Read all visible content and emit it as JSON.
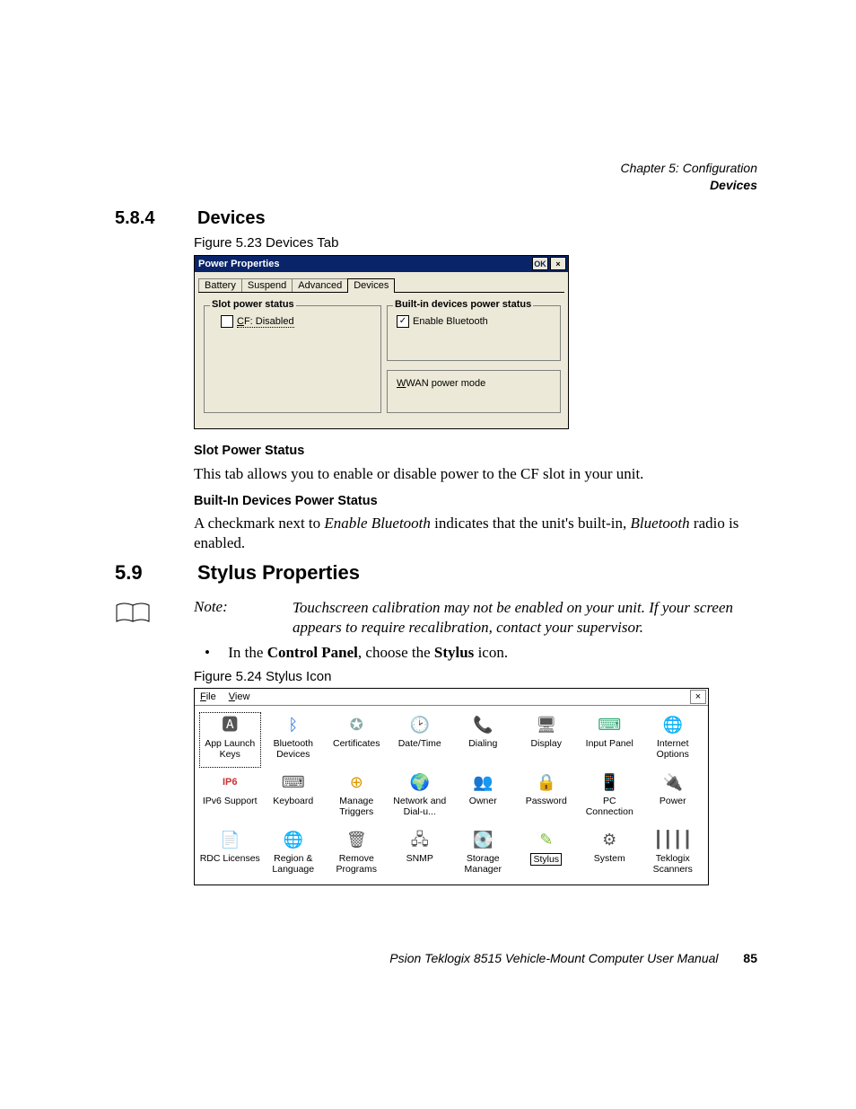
{
  "runningHead": {
    "line1": "Chapter 5: Configuration",
    "line2": "Devices"
  },
  "sec584": {
    "num": "5.8.4",
    "title": "Devices"
  },
  "fig523": "Figure 5.23 Devices Tab",
  "dlg": {
    "title": "Power Properties",
    "ok": "OK",
    "close": "×",
    "tabs": [
      "Battery",
      "Suspend",
      "Advanced",
      "Devices"
    ],
    "activeTab": 3,
    "grp1": {
      "legend": "Slot power status",
      "cfPrefix": "C",
      "cfRest": "F: Disabled",
      "checked": false
    },
    "grp2": {
      "legend": "Built-in devices power status",
      "label": "Enable Bluetooth",
      "checked": true
    },
    "grp3": {
      "legend": "",
      "wPrefix": "W",
      "wRest": "WAN power mode"
    }
  },
  "h4a": "Slot Power Status",
  "p1": "This tab allows you to enable or disable power to the CF slot in your unit.",
  "h4b": "Built-In Devices Power Status",
  "p2a": "A checkmark next to ",
  "p2b": "Enable Bluetooth",
  "p2c": " indicates that the unit's built-in, ",
  "p2d": "Bluetooth",
  "p2e": " radio is enabled.",
  "sec59": {
    "num": "5.9",
    "title": "Stylus Properties"
  },
  "note": {
    "label": "Note:",
    "text": "Touchscreen calibration may not be enabled on your unit. If your screen appears to require recalibration, contact your supervisor."
  },
  "bullet": {
    "a": "In the ",
    "b": "Control Panel",
    "c": ", choose the ",
    "d": "Stylus",
    "e": " icon."
  },
  "fig524": "Figure 5.24 Stylus Icon",
  "cp": {
    "menuFile": {
      "u": "F",
      "rest": "ile"
    },
    "menuView": {
      "u": "V",
      "rest": "iew"
    },
    "close": "×",
    "items": [
      {
        "label": "App Launch Keys",
        "sel": "dotted",
        "glyph": "🅰"
      },
      {
        "label": "Bluetooth Devices",
        "glyph": "ᛒ",
        "color": "#1e6fd8"
      },
      {
        "label": "Certificates",
        "glyph": "✪",
        "color": "#8aa"
      },
      {
        "label": "Date/Time",
        "glyph": "🕑"
      },
      {
        "label": "Dialing",
        "glyph": "📞"
      },
      {
        "label": "Display",
        "glyph": "🖥"
      },
      {
        "label": "Input Panel",
        "glyph": "⌨",
        "color": "#3a7"
      },
      {
        "label": "Internet Options",
        "glyph": "🌐",
        "color": "#2a7"
      },
      {
        "label": "IPv6 Support",
        "glyph": "IP6",
        "color": "#c33",
        "textIcon": true
      },
      {
        "label": "Keyboard",
        "glyph": "⌨"
      },
      {
        "label": "Manage Triggers",
        "glyph": "⊕",
        "color": "#d90"
      },
      {
        "label": "Network and Dial-u...",
        "glyph": "🌍"
      },
      {
        "label": "Owner",
        "glyph": "👥"
      },
      {
        "label": "Password",
        "glyph": "🔒"
      },
      {
        "label": "PC Connection",
        "glyph": "📱",
        "color": "#c55"
      },
      {
        "label": "Power",
        "glyph": "🔌"
      },
      {
        "label": "RDC Licenses",
        "glyph": "📄"
      },
      {
        "label": "Region & Language",
        "glyph": "🌐",
        "color": "#38c"
      },
      {
        "label": "Remove Programs",
        "glyph": "🗑"
      },
      {
        "label": "SNMP",
        "glyph": "🖧"
      },
      {
        "label": "Storage Manager",
        "glyph": "💽"
      },
      {
        "label": "Stylus",
        "sel": "solid",
        "glyph": "✎",
        "color": "#7b3"
      },
      {
        "label": "System",
        "glyph": "⚙"
      },
      {
        "label": "Teklogix Scanners",
        "glyph": "┃┃┃┃"
      }
    ]
  },
  "footer": {
    "text": "Psion Teklogix 8515 Vehicle-Mount Computer User Manual",
    "page": "85"
  }
}
